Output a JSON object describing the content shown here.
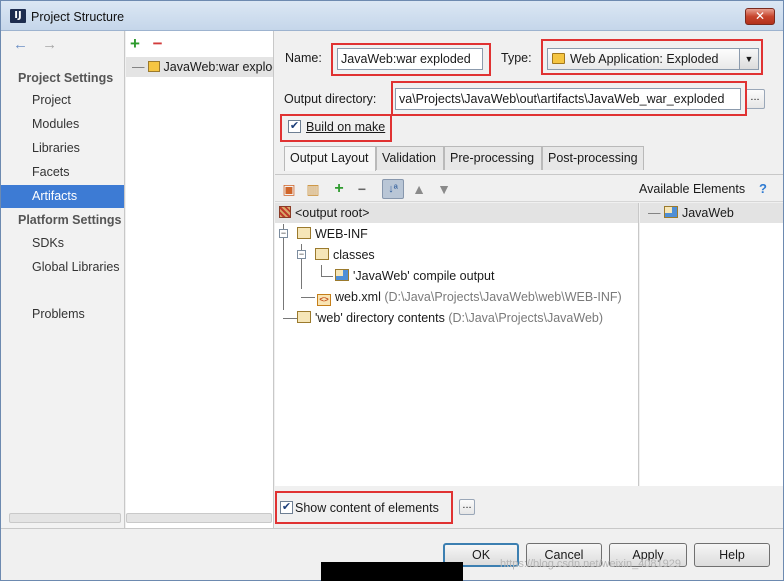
{
  "window": {
    "title": "Project Structure",
    "icon": "intellij-icon"
  },
  "nav": {
    "back": "←",
    "forward": "→",
    "sections": [
      {
        "title": "Project Settings",
        "items": [
          "Project",
          "Modules",
          "Libraries",
          "Facets",
          "Artifacts"
        ]
      },
      {
        "title": "Platform Settings",
        "items": [
          "SDKs",
          "Global Libraries"
        ]
      }
    ],
    "problems": "Problems",
    "selected": "Artifacts"
  },
  "artifacts": {
    "add": "+",
    "remove": "−",
    "items": [
      "JavaWeb:war exploded"
    ]
  },
  "form": {
    "name_label": "Name:",
    "name_value": "JavaWeb:war exploded",
    "type_label": "Type:",
    "type_value": "Web Application: Exploded",
    "output_label": "Output directory:",
    "output_value": "va\\Projects\\JavaWeb\\out\\artifacts\\JavaWeb_war_exploded",
    "browse": "...",
    "build_on_make_label": "Build on make",
    "build_on_make_checked": true
  },
  "tabs": [
    "Output Layout",
    "Validation",
    "Pre-processing",
    "Post-processing"
  ],
  "active_tab": "Output Layout",
  "layout": {
    "available_label": "Available Elements",
    "help": "?",
    "tree": {
      "root": "<output root>",
      "web_inf": "WEB-INF",
      "classes": "classes",
      "compile_output": "'JavaWeb' compile output",
      "web_xml": "web.xml",
      "web_xml_path": "(D:\\Java\\Projects\\JavaWeb\\web\\WEB-INF)",
      "web_dir": "'web' directory contents",
      "web_dir_path": "(D:\\Java\\Projects\\JavaWeb)"
    },
    "available": [
      "JavaWeb"
    ],
    "show_content_label": "Show content of elements",
    "show_content_checked": true,
    "show_content_more": "..."
  },
  "buttons": {
    "ok": "OK",
    "cancel": "Cancel",
    "apply": "Apply",
    "help": "Help"
  },
  "watermark": "https://blog.csdn.net/weixin_4081929"
}
